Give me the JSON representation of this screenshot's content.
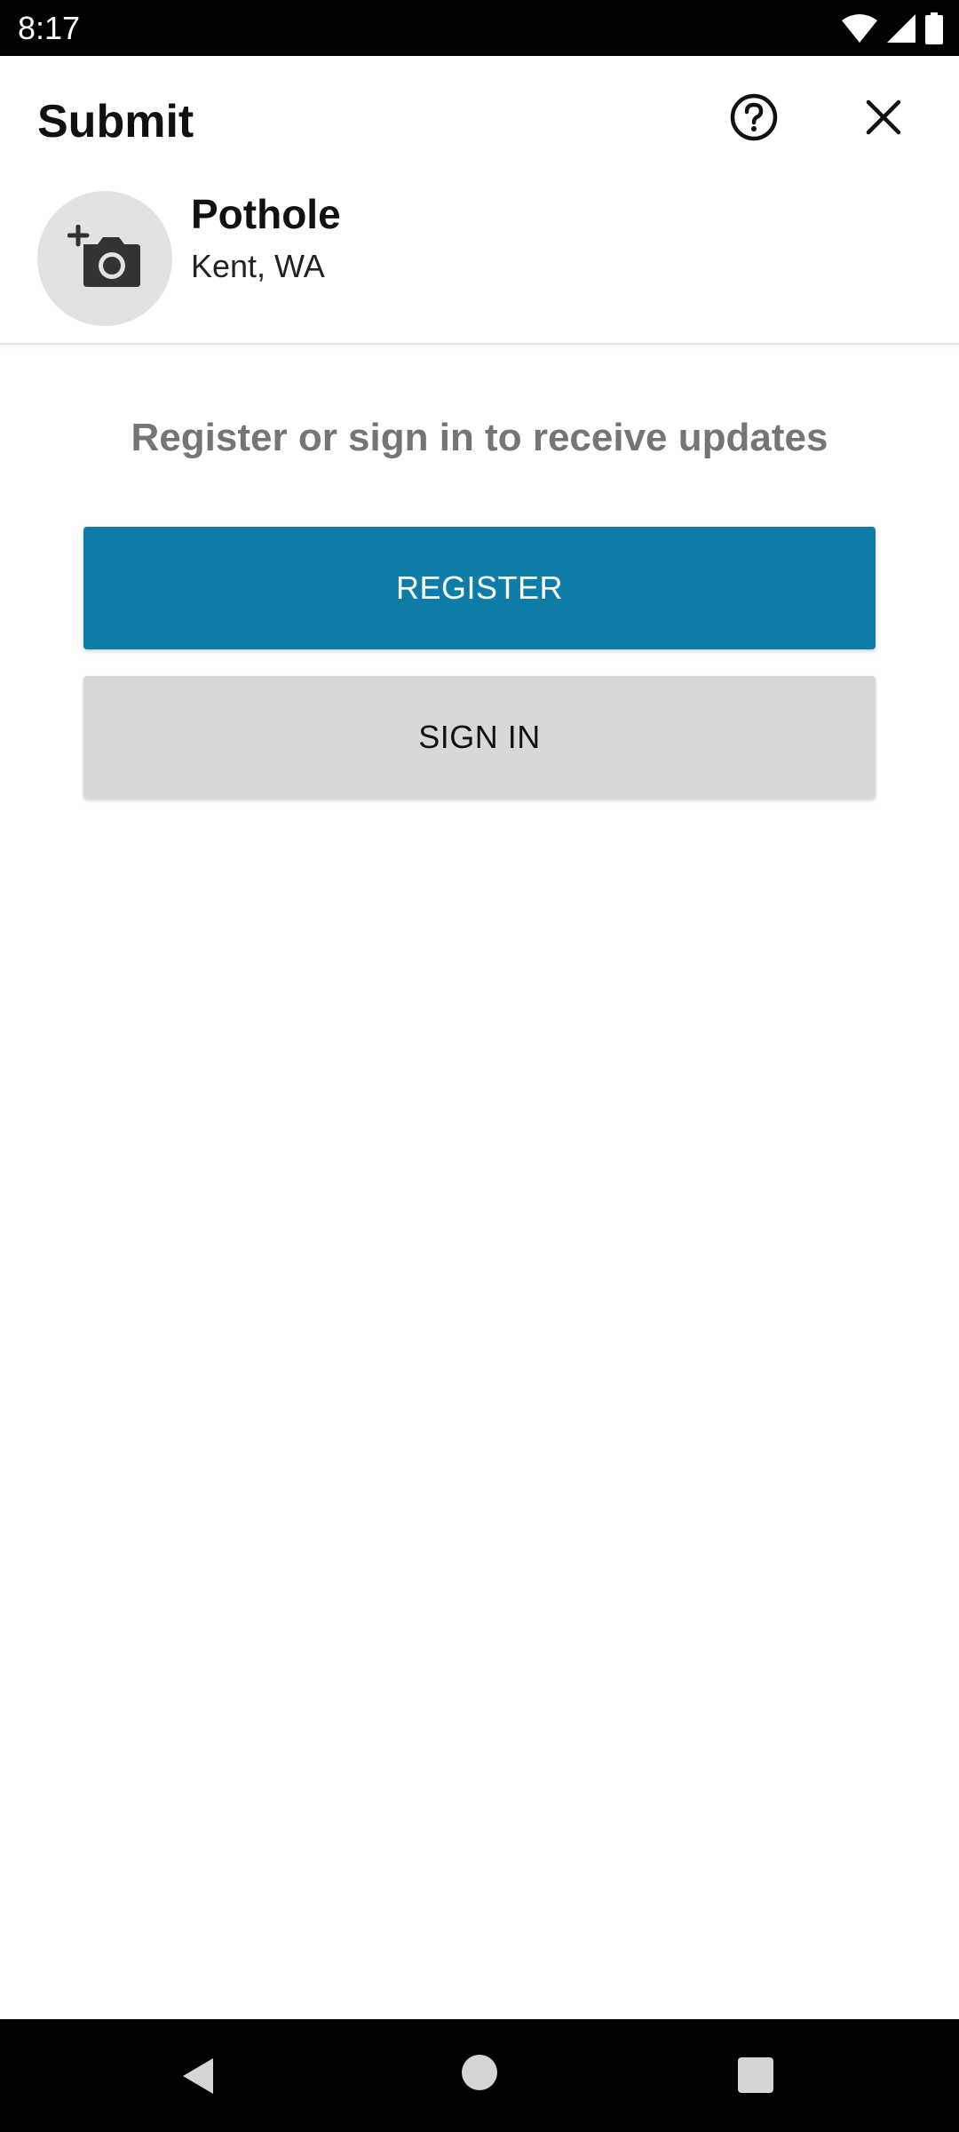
{
  "status_bar": {
    "time": "8:17",
    "icons": [
      "wifi-icon",
      "cell-signal-icon",
      "battery-icon"
    ]
  },
  "header": {
    "title": "Submit",
    "help_icon": "help-circle-icon",
    "close_icon": "close-icon",
    "photo_icon": "add-photo-camera-icon",
    "issue_name": "Pothole",
    "issue_location": "Kent, WA"
  },
  "content": {
    "prompt": "Register or sign in to receive updates",
    "register_label": "REGISTER",
    "signin_label": "SIGN IN"
  },
  "nav_bar": {
    "icons": [
      "back-icon",
      "home-icon",
      "recents-icon"
    ]
  },
  "colors": {
    "primary": "#0e7ca8",
    "secondary_button": "#d7d8d8",
    "prompt_text": "#757575",
    "avatar_bg": "#e2e2e2"
  }
}
